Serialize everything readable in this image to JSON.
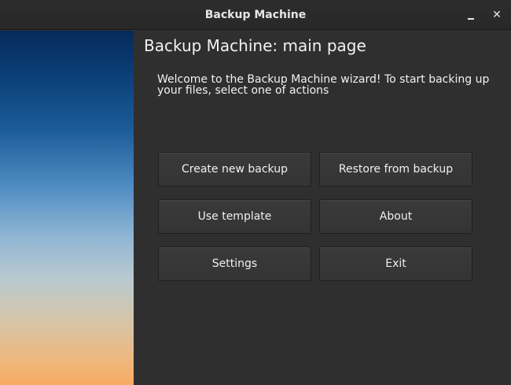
{
  "window": {
    "title": "Backup Machine",
    "minimize_icon": "minimize-icon",
    "close_icon": "close-icon",
    "close_glyph": "✕"
  },
  "main": {
    "title": "Backup Machine: main page",
    "welcome": "Welcome to the Backup Machine wizard! To start backing up your files, select one of actions",
    "buttons": {
      "create": "Create new backup",
      "restore": "Restore from backup",
      "template": "Use template",
      "about": "About",
      "settings": "Settings",
      "exit": "Exit"
    }
  },
  "colors": {
    "background": "#2f2f2f",
    "text": "#f2f2f2",
    "button": "#383838"
  }
}
